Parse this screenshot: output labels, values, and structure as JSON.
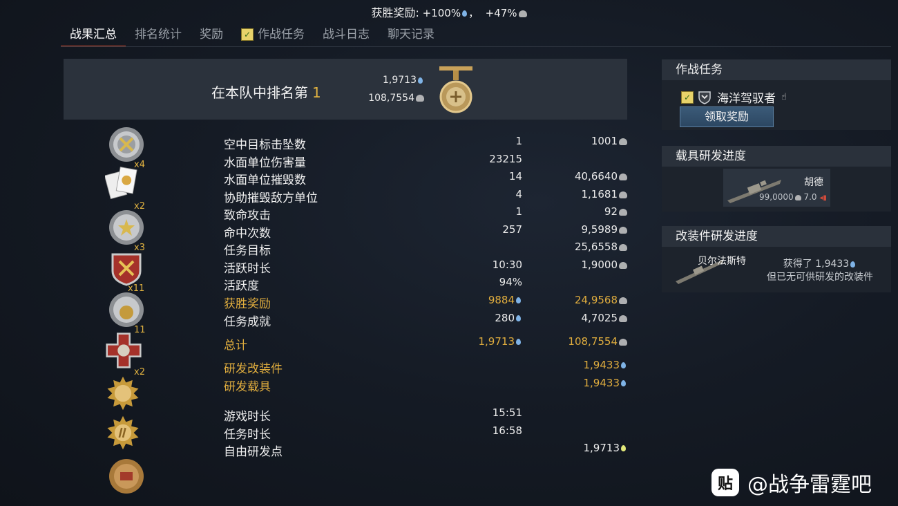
{
  "banner": {
    "label": "获胜奖励:",
    "rp_bonus": "+100%",
    "separator": "，",
    "sl_bonus": "+47%"
  },
  "tabs": [
    {
      "label": "战果汇总",
      "active": true
    },
    {
      "label": "排名统计"
    },
    {
      "label": "奖励"
    },
    {
      "label": "作战任务",
      "has_check": true
    },
    {
      "label": "战斗日志"
    },
    {
      "label": "聊天记录"
    }
  ],
  "rank": {
    "text": "在本队中排名第",
    "position": "1",
    "rp": "1,9713",
    "sl": "108,7554"
  },
  "medal_counts": [
    "x4",
    "x2",
    "x3",
    "x11",
    "11",
    "x2"
  ],
  "stats": [
    {
      "name": "空中目标击坠数",
      "v1": "1",
      "v2": "1001",
      "v2_icon": "eagle-icon"
    },
    {
      "name": "水面单位伤害量",
      "v1": "23215",
      "v2": ""
    },
    {
      "name": "水面单位摧毁数",
      "v1": "14",
      "v2": "40,6640",
      "v2_icon": "eagle-icon"
    },
    {
      "name": "协助摧毁敌方单位",
      "v1": "4",
      "v2": "1,1681",
      "v2_icon": "eagle-icon"
    },
    {
      "name": "致命攻击",
      "v1": "1",
      "v2": "92",
      "v2_icon": "eagle-icon"
    },
    {
      "name": "命中次数",
      "v1": "257",
      "v2": "9,5989",
      "v2_icon": "eagle-icon"
    },
    {
      "name": "任务目标",
      "v1": "",
      "v2": "25,6558",
      "v2_icon": "eagle-icon"
    },
    {
      "name": "活跃时长",
      "v1": "10:30",
      "v2": "1,9000",
      "v2_icon": "eagle-icon"
    },
    {
      "name": "活跃度",
      "v1": "94%",
      "v2": ""
    },
    {
      "name": "获胜奖励",
      "v1": "9884",
      "v1_icon": "drop-icon",
      "v2": "24,9568",
      "v2_icon": "eagle-icon",
      "gold": true
    },
    {
      "name": "任务成就",
      "v1": "280",
      "v1_icon": "drop-icon",
      "v2": "4,7025",
      "v2_icon": "eagle-icon"
    }
  ],
  "totals": [
    {
      "name": "总计",
      "v1": "1,9713",
      "v1_icon": "drop-icon",
      "v2": "108,7554",
      "v2_icon": "eagle-icon",
      "gold": true
    },
    {
      "name": "研发改装件",
      "v1": "",
      "v2": "1,9433",
      "v2_icon": "drop-icon",
      "gold": true
    },
    {
      "name": "研发载具",
      "v1": "",
      "v2": "1,9433",
      "v2_icon": "drop-icon",
      "gold": true
    }
  ],
  "times": [
    {
      "name": "游戏时长",
      "v1": "15:51",
      "v2": ""
    },
    {
      "name": "任务时长",
      "v1": "16:58",
      "v2": ""
    },
    {
      "name": "自由研发点",
      "v1": "",
      "v2": "1,9713",
      "v2_icon": "yellow-drop-icon"
    }
  ],
  "mission_panel": {
    "title": "作战任务",
    "task_name": "海洋驾驭者",
    "claim_label": "领取奖励"
  },
  "vehicle_panel": {
    "title": "载具研发进度",
    "vehicle_name": "胡德",
    "rp_value": "99,0000",
    "br": "7.0"
  },
  "mod_panel": {
    "title": "改装件研发进度",
    "ship_name": "贝尔法斯特",
    "gained_label": "获得了 1,9433",
    "no_mods_text": "但已无可供研发的改装件"
  },
  "watermark": {
    "icon_text": "贴",
    "text": "@战争雷霆吧"
  }
}
